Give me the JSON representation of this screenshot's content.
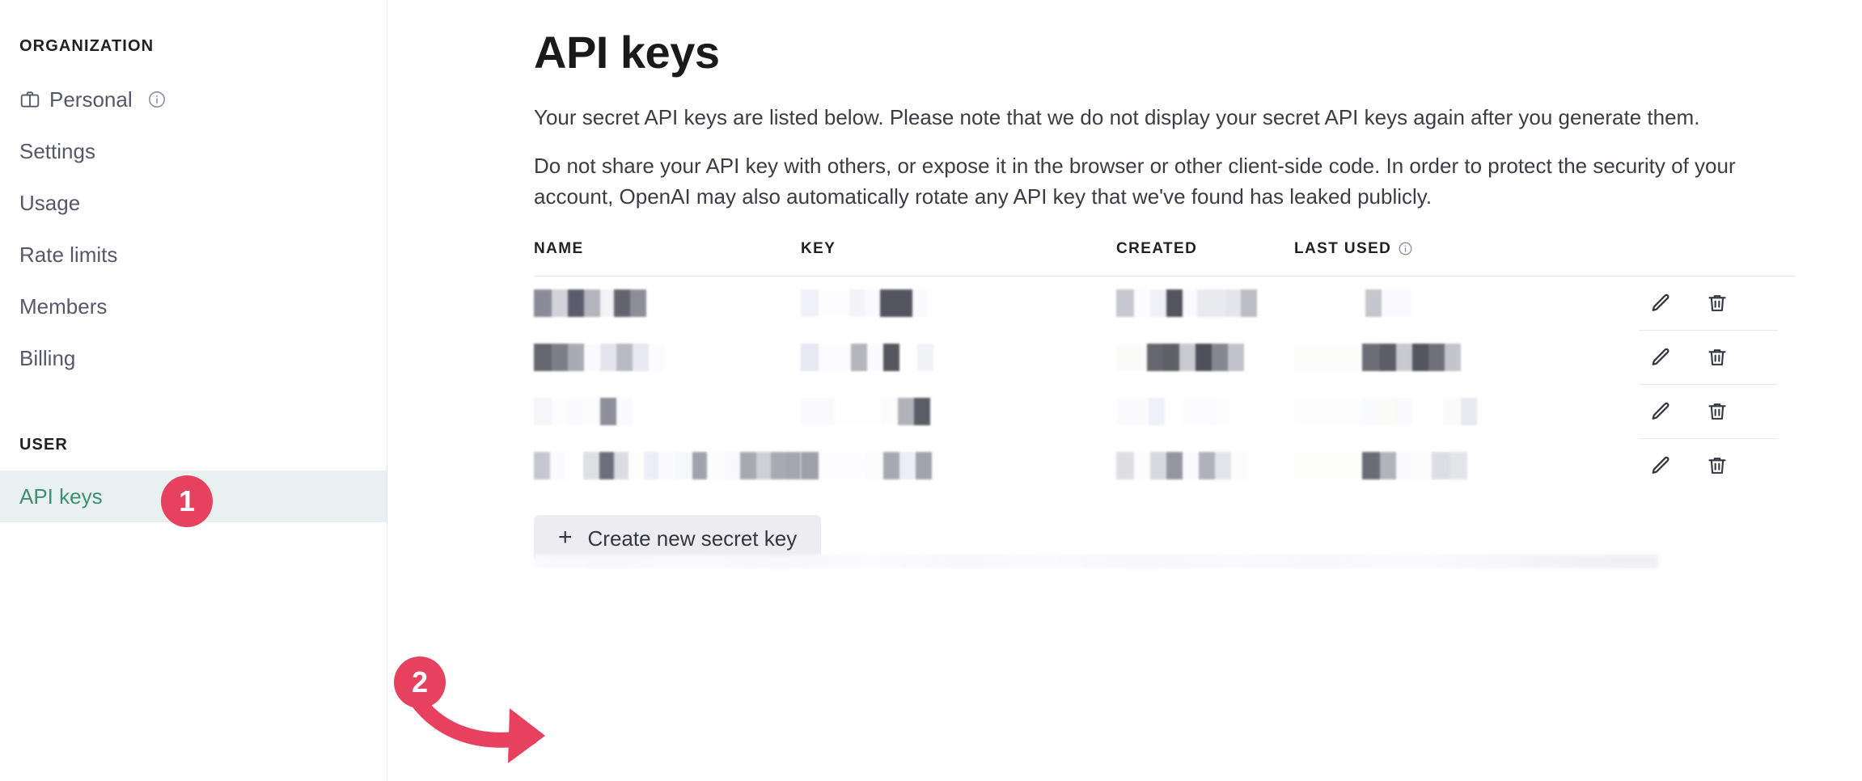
{
  "sidebar": {
    "org_section_label": "ORGANIZATION",
    "user_section_label": "USER",
    "org_items": [
      {
        "label": "Personal",
        "icon": "briefcase-icon",
        "trailing_icon": "info-icon",
        "active": false
      },
      {
        "label": "Settings",
        "icon": "",
        "trailing_icon": "",
        "active": false
      },
      {
        "label": "Usage",
        "icon": "",
        "trailing_icon": "",
        "active": false
      },
      {
        "label": "Rate limits",
        "icon": "",
        "trailing_icon": "",
        "active": false
      },
      {
        "label": "Members",
        "icon": "",
        "trailing_icon": "",
        "active": false
      },
      {
        "label": "Billing",
        "icon": "",
        "trailing_icon": "",
        "active": false
      }
    ],
    "user_items": [
      {
        "label": "API keys",
        "active": true
      }
    ],
    "active_bg": "#e8f1f0",
    "active_text": "#3f8f73"
  },
  "main": {
    "title": "API keys",
    "paragraph_1": "Your secret API keys are listed below. Please note that we do not display your secret API keys again after you generate them.",
    "paragraph_2": "Do not share your API key with others, or expose it in the browser or other client-side code. In order to protect the security of your account, OpenAI may also automatically rotate any API key that we've found has leaked publicly.",
    "table": {
      "headers": [
        {
          "label": "NAME",
          "info": false
        },
        {
          "label": "KEY",
          "info": false
        },
        {
          "label": "CREATED",
          "info": false
        },
        {
          "label": "LAST USED",
          "info": true
        },
        {
          "label": "",
          "info": false
        }
      ],
      "rows": [
        {
          "name": "redacted",
          "key": "redacted",
          "created": "redacted",
          "last_used": "redacted",
          "edit_icon": "pencil-icon",
          "delete_icon": "trash-icon"
        },
        {
          "name": "redacted",
          "key": "redacted",
          "created": "redacted",
          "last_used": "redacted",
          "edit_icon": "pencil-icon",
          "delete_icon": "trash-icon"
        },
        {
          "name": "redacted",
          "key": "redacted",
          "created": "redacted",
          "last_used": "redacted",
          "edit_icon": "pencil-icon",
          "delete_icon": "trash-icon"
        },
        {
          "name": "redacted",
          "key": "redacted",
          "created": "redacted",
          "last_used": "redacted",
          "edit_icon": "pencil-icon",
          "delete_icon": "trash-icon"
        }
      ]
    },
    "create_button": {
      "label": "Create new secret key",
      "plus": "+",
      "bg": "#ececf1"
    }
  },
  "annotations": {
    "badge_color": "#e8415f",
    "steps": [
      {
        "number": "1",
        "target": "sidebar-item-api-keys"
      },
      {
        "number": "2",
        "target": "create-new-secret-key-button"
      }
    ],
    "arrow": {
      "from_step": "2",
      "to": "create-new-secret-key-button",
      "color": "#e8415f"
    }
  }
}
